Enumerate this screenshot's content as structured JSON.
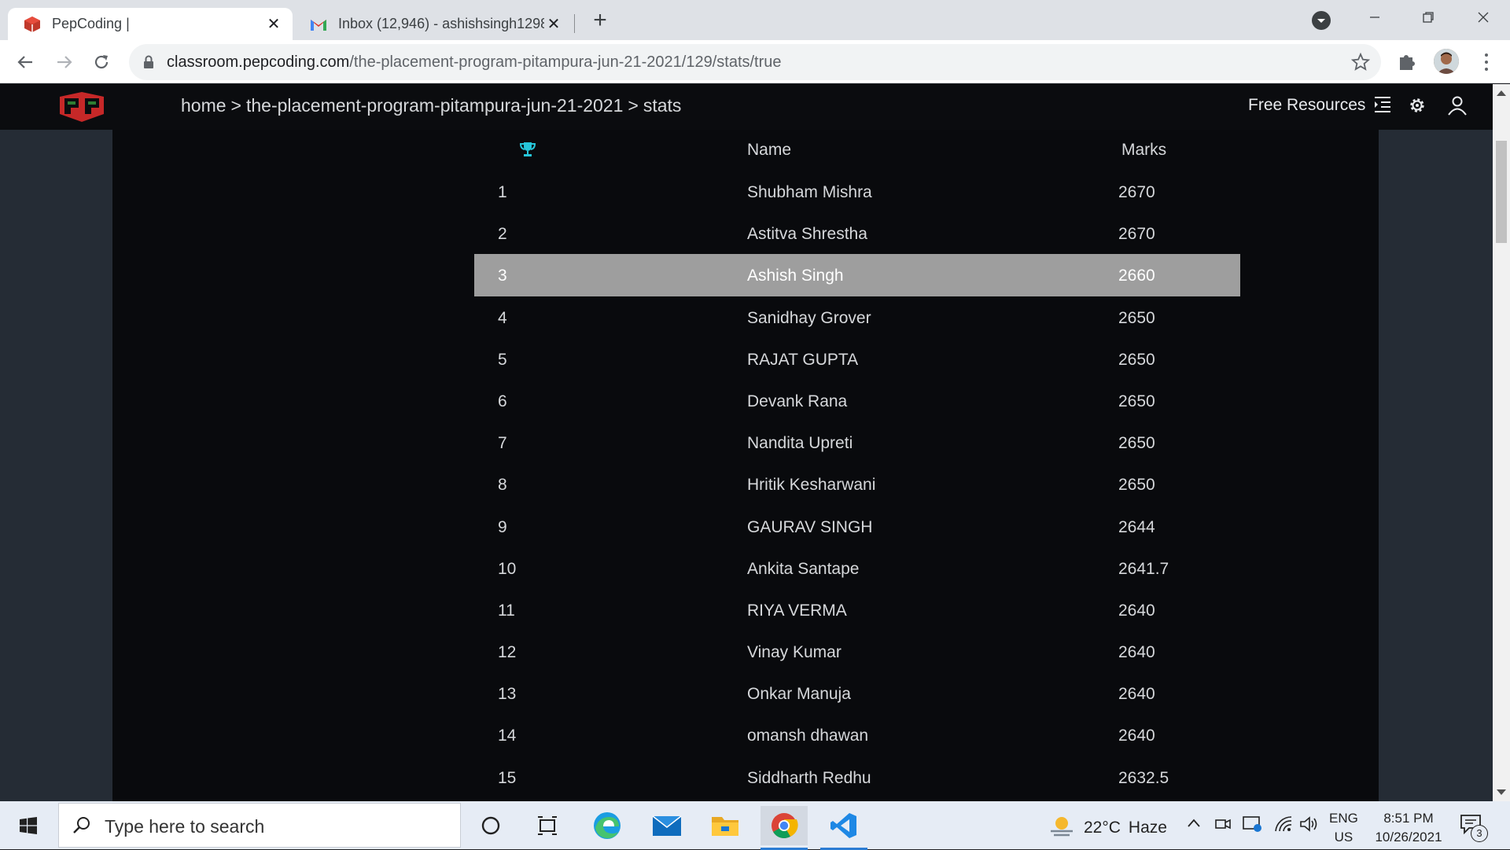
{
  "browser": {
    "tabs": [
      {
        "title": "PepCoding |",
        "active": true,
        "favicon": "pepcoding-logo-icon"
      },
      {
        "title": "Inbox (12,946) - ashishsingh1298",
        "active": false,
        "favicon": "gmail-icon"
      }
    ],
    "url_host": "classroom.pepcoding.com",
    "url_path": "/the-placement-program-pitampura-jun-21-2021/129/stats/true"
  },
  "site": {
    "breadcrumb": [
      "home",
      "the-placement-program-pitampura-jun-21-2021",
      "stats"
    ],
    "breadcrumb_sep": ">",
    "free_resources": "Free Resources"
  },
  "leaderboard": {
    "headers": {
      "rank_icon": "trophy-icon",
      "name": "Name",
      "marks": "Marks"
    },
    "highlight_color": "#9e9e9e",
    "highlighted_rank": "3",
    "rows": [
      {
        "rank": "1",
        "name": "Shubham Mishra",
        "marks": "2670"
      },
      {
        "rank": "2",
        "name": "Astitva Shrestha",
        "marks": "2670"
      },
      {
        "rank": "3",
        "name": "Ashish Singh",
        "marks": "2660"
      },
      {
        "rank": "4",
        "name": "Sanidhay Grover",
        "marks": "2650"
      },
      {
        "rank": "5",
        "name": "RAJAT GUPTA",
        "marks": "2650"
      },
      {
        "rank": "6",
        "name": "Devank Rana",
        "marks": "2650"
      },
      {
        "rank": "7",
        "name": "Nandita Upreti",
        "marks": "2650"
      },
      {
        "rank": "8",
        "name": "Hritik Kesharwani",
        "marks": "2650"
      },
      {
        "rank": "9",
        "name": "GAURAV SINGH",
        "marks": "2644"
      },
      {
        "rank": "10",
        "name": "Ankita Santape",
        "marks": "2641.7"
      },
      {
        "rank": "11",
        "name": "RIYA VERMA",
        "marks": "2640"
      },
      {
        "rank": "12",
        "name": "Vinay Kumar",
        "marks": "2640"
      },
      {
        "rank": "13",
        "name": "Onkar Manuja",
        "marks": "2640"
      },
      {
        "rank": "14",
        "name": "omansh dhawan",
        "marks": "2640"
      },
      {
        "rank": "15",
        "name": "Siddharth Redhu",
        "marks": "2632.5"
      }
    ]
  },
  "taskbar": {
    "search_placeholder": "Type here to search",
    "weather_temp": "22°C",
    "weather_cond": "Haze",
    "lang_top": "ENG",
    "lang_bottom": "US",
    "time": "8:51 PM",
    "date": "10/26/2021",
    "notification_count": "3"
  }
}
